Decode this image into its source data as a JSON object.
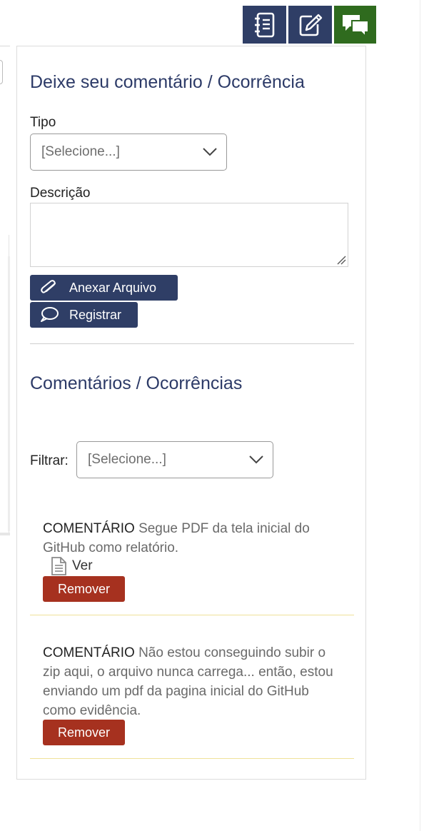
{
  "toolbar": {
    "buttons": [
      {
        "icon": "notebook-icon",
        "active": false
      },
      {
        "icon": "edit-note-icon",
        "active": false
      },
      {
        "icon": "chat-bubbles-icon",
        "active": true
      }
    ],
    "active_color": "#2f6b1e",
    "default_color": "#2f3e66"
  },
  "form": {
    "title": "Deixe seu comentário / Ocorrência",
    "tipo_label": "Tipo",
    "tipo_value": "[Selecione...]",
    "descricao_label": "Descrição",
    "descricao_value": "",
    "attach_label": "Anexar Arquivo",
    "attach_icon": "paperclip-icon",
    "submit_label": "Registrar",
    "submit_icon": "speech-bubble-icon"
  },
  "comments": {
    "title": "Comentários / Ocorrências",
    "filter_label": "Filtrar:",
    "filter_value": "[Selecione...]",
    "items": [
      {
        "type": "COMENTÁRIO",
        "text": "Segue PDF da tela inicial do GitHub como relatório.",
        "attachment_label": "Ver",
        "attachment_icon": "document-icon",
        "remove_label": "Remover"
      },
      {
        "type": "COMENTÁRIO",
        "text": "Não estou conseguindo subir o zip aqui, o arquivo nunca carrega... então, estou enviando um pdf da pagina inicial do GitHub como evidência.",
        "remove_label": "Remover"
      }
    ]
  },
  "colors": {
    "heading": "#2c3a67",
    "primary_button": "#2f3e66",
    "danger_button": "#a6311f",
    "separator": "#efe19a"
  }
}
